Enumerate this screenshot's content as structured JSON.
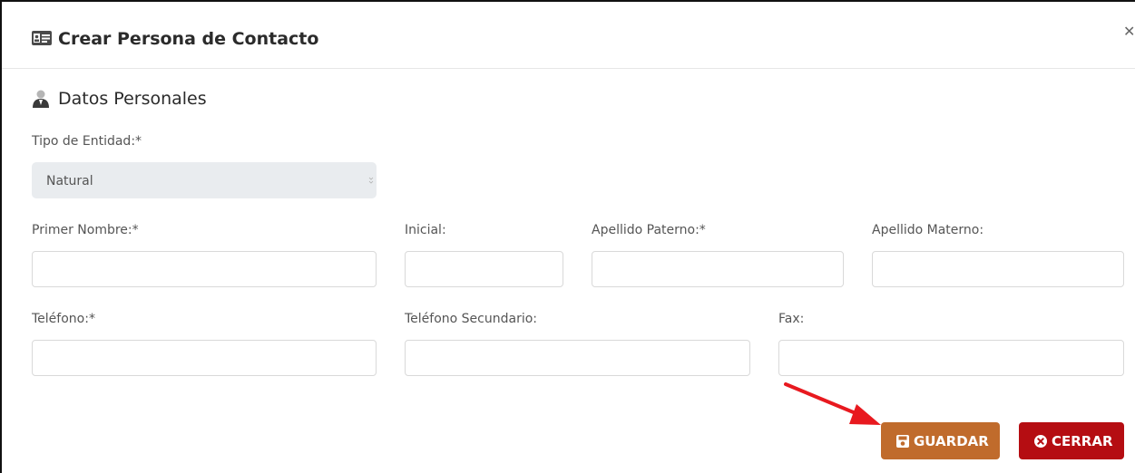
{
  "modal": {
    "title": "Crear Persona de Contacto",
    "close_icon": "close-icon"
  },
  "section": {
    "title": "Datos Personales",
    "icon": "user-icon"
  },
  "fields": {
    "tipo_entidad": {
      "label": "Tipo de Entidad:*",
      "value": "Natural"
    },
    "primer_nombre": {
      "label": "Primer Nombre:*",
      "value": ""
    },
    "inicial": {
      "label": "Inicial:",
      "value": ""
    },
    "apellido_paterno": {
      "label": "Apellido Paterno:*",
      "value": ""
    },
    "apellido_materno": {
      "label": "Apellido Materno:",
      "value": ""
    },
    "telefono": {
      "label": "Teléfono:*",
      "value": ""
    },
    "telefono_secundario": {
      "label": "Teléfono Secundario:",
      "value": ""
    },
    "fax": {
      "label": "Fax:",
      "value": ""
    }
  },
  "buttons": {
    "guardar": {
      "label": "GUARDAR",
      "icon": "save-icon",
      "color": "#c06b2c"
    },
    "cerrar": {
      "label": "CERRAR",
      "icon": "close-circle-icon",
      "color": "#b50d12"
    }
  },
  "annotation": {
    "arrow_color": "#e8191f"
  }
}
